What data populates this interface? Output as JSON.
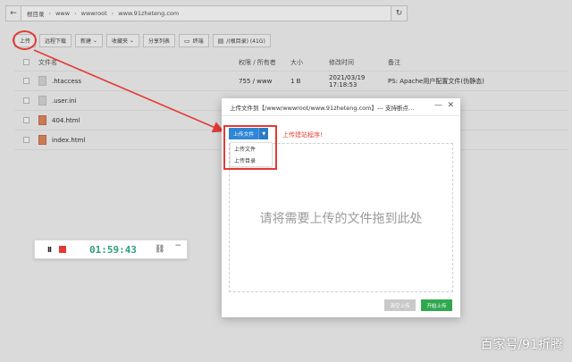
{
  "pathbar": {
    "back_icon": "arrow-left-icon",
    "crumbs": [
      "根目录",
      "www",
      "wwwroot",
      "www.91zheteng.com"
    ],
    "refresh_icon": "refresh-icon"
  },
  "toolbar": {
    "upload": "上传",
    "remote_download": "远程下载",
    "new": "新建",
    "favorites": "收藏夹",
    "share_list": "分享列表",
    "terminal": "终端",
    "disk": "/(根目录) (41G)"
  },
  "table": {
    "headers": {
      "name": "文件名",
      "perm": "权限 / 所有者",
      "size": "大小",
      "time": "修改时间",
      "note": "备注"
    },
    "rows": [
      {
        "name": ".htaccess",
        "perm": "755 / www",
        "size": "1 B",
        "time": "2021/03/19 17:18:53",
        "note": "PS: Apache用户配置文件(伪静态)",
        "type": "file"
      },
      {
        "name": ".user.ini",
        "perm": "",
        "size": "",
        "time": "",
        "note": "",
        "type": "file"
      },
      {
        "name": "404.html",
        "perm": "",
        "size": "",
        "time": "",
        "note": "",
        "type": "html"
      },
      {
        "name": "index.html",
        "perm": "",
        "size": "",
        "time": "",
        "note": "",
        "type": "html"
      }
    ]
  },
  "recorder": {
    "pause": "II",
    "time": "01:59:43",
    "link_icon": "link-icon",
    "minimize": "−"
  },
  "dialog": {
    "title": "上传文件到【/www/wwwroot/www.91zheteng.com】--- 支持断点...",
    "minimize": "—",
    "close": "✕",
    "upload_button": "上传文件",
    "caret": "▼",
    "menu_items": [
      "上传文件",
      "上传目录"
    ],
    "hint": "上传建站程序!",
    "drop_text": "请将需要上传的文件拖到此处",
    "clear_button": "清空上传",
    "start_button": "开始上传"
  },
  "watermark": "百家号/91折腾",
  "colors": {
    "accent": "#2f86d6",
    "success": "#2fa84f",
    "annotation": "#e33a34",
    "timer": "#2e9e82"
  }
}
